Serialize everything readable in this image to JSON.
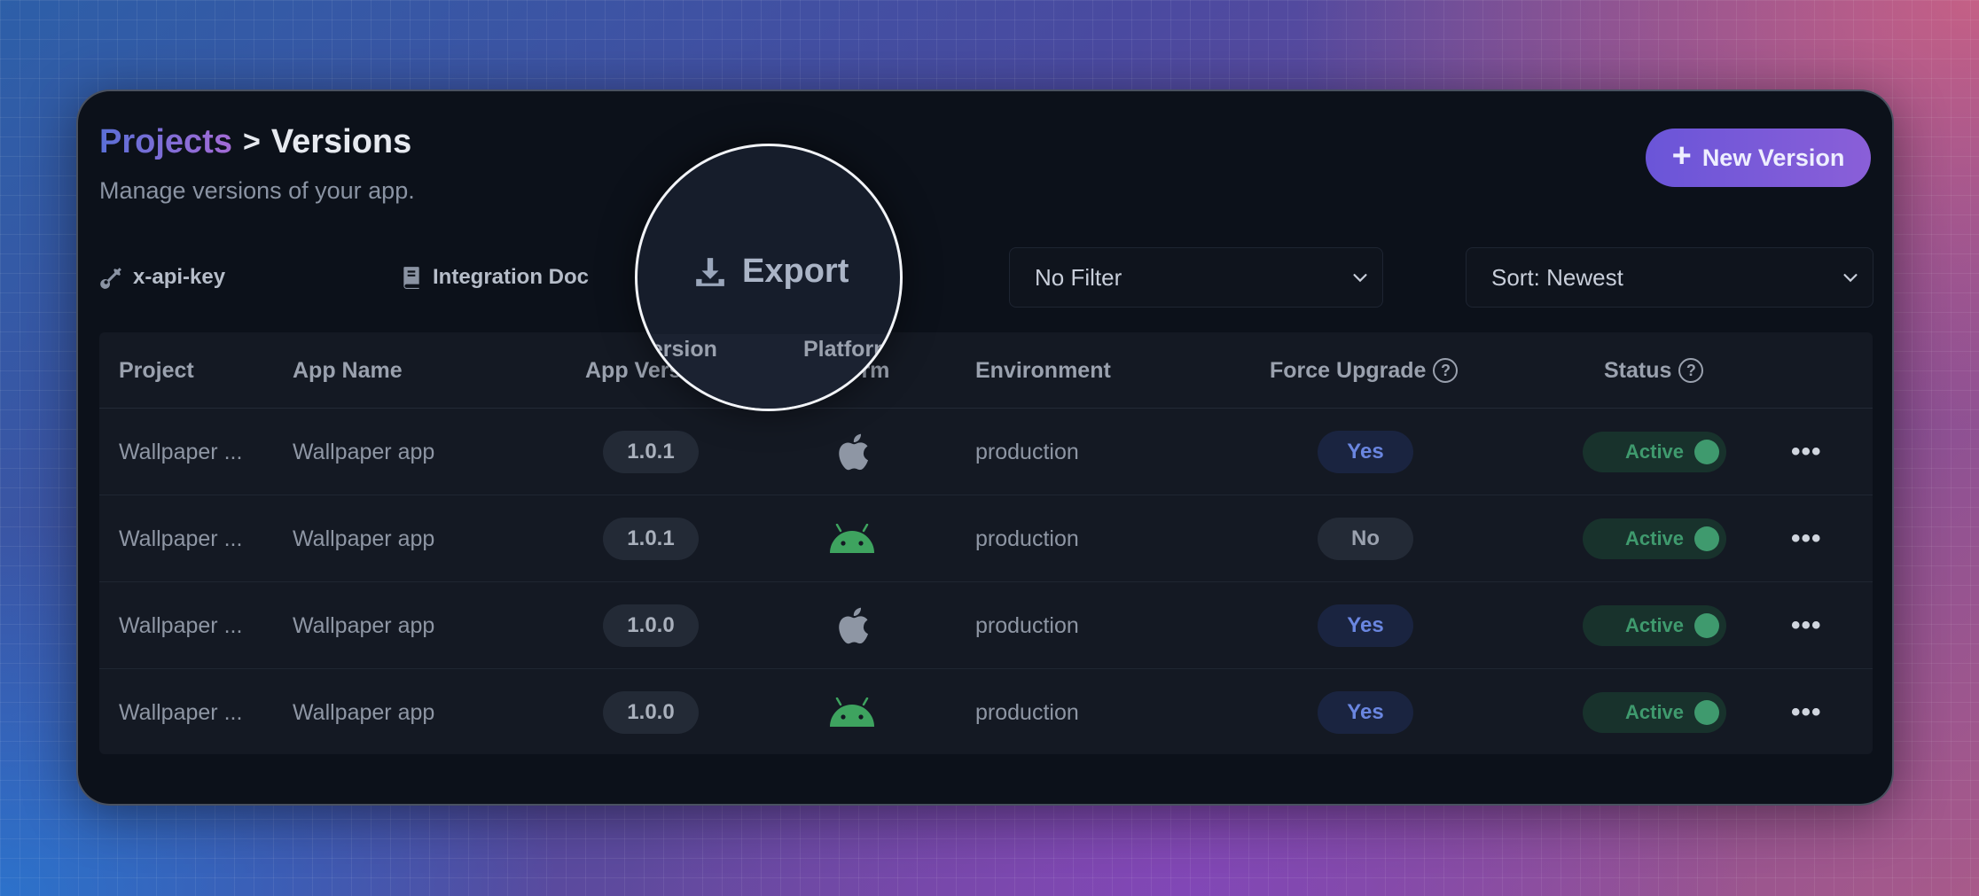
{
  "breadcrumb": {
    "parent": "Projects",
    "separator": ">",
    "current": "Versions"
  },
  "subtitle": "Manage versions of your app.",
  "new_version_label": "New Version",
  "toolbar": {
    "api_key_label": "x-api-key",
    "integration_doc_label": "Integration Doc",
    "export_label": "Export",
    "filter_value": "No Filter",
    "sort_value": "Sort: Newest"
  },
  "table": {
    "headers": {
      "project": "Project",
      "app_name": "App Name",
      "app_version": "App Version",
      "platform": "Platform",
      "environment": "Environment",
      "force_upgrade": "Force Upgrade",
      "status": "Status"
    },
    "rows": [
      {
        "project": "Wallpaper ...",
        "app_name": "Wallpaper app",
        "version": "1.0.1",
        "platform": "apple-icon",
        "environment": "production",
        "force_upgrade": "Yes",
        "status": "Active"
      },
      {
        "project": "Wallpaper ...",
        "app_name": "Wallpaper app",
        "version": "1.0.1",
        "platform": "android-icon",
        "environment": "production",
        "force_upgrade": "No",
        "status": "Active"
      },
      {
        "project": "Wallpaper ...",
        "app_name": "Wallpaper app",
        "version": "1.0.0",
        "platform": "apple-icon",
        "environment": "production",
        "force_upgrade": "Yes",
        "status": "Active"
      },
      {
        "project": "Wallpaper ...",
        "app_name": "Wallpaper app",
        "version": "1.0.0",
        "platform": "android-icon",
        "environment": "production",
        "force_upgrade": "Yes",
        "status": "Active"
      }
    ],
    "help_glyph": "?",
    "more_glyph": "•••"
  },
  "colors": {
    "accent": "#7a5ad8",
    "android": "#3ea35f",
    "apple": "#8e96a4",
    "status_active": "#3f9a6e",
    "force_yes": "#6a86e0"
  }
}
